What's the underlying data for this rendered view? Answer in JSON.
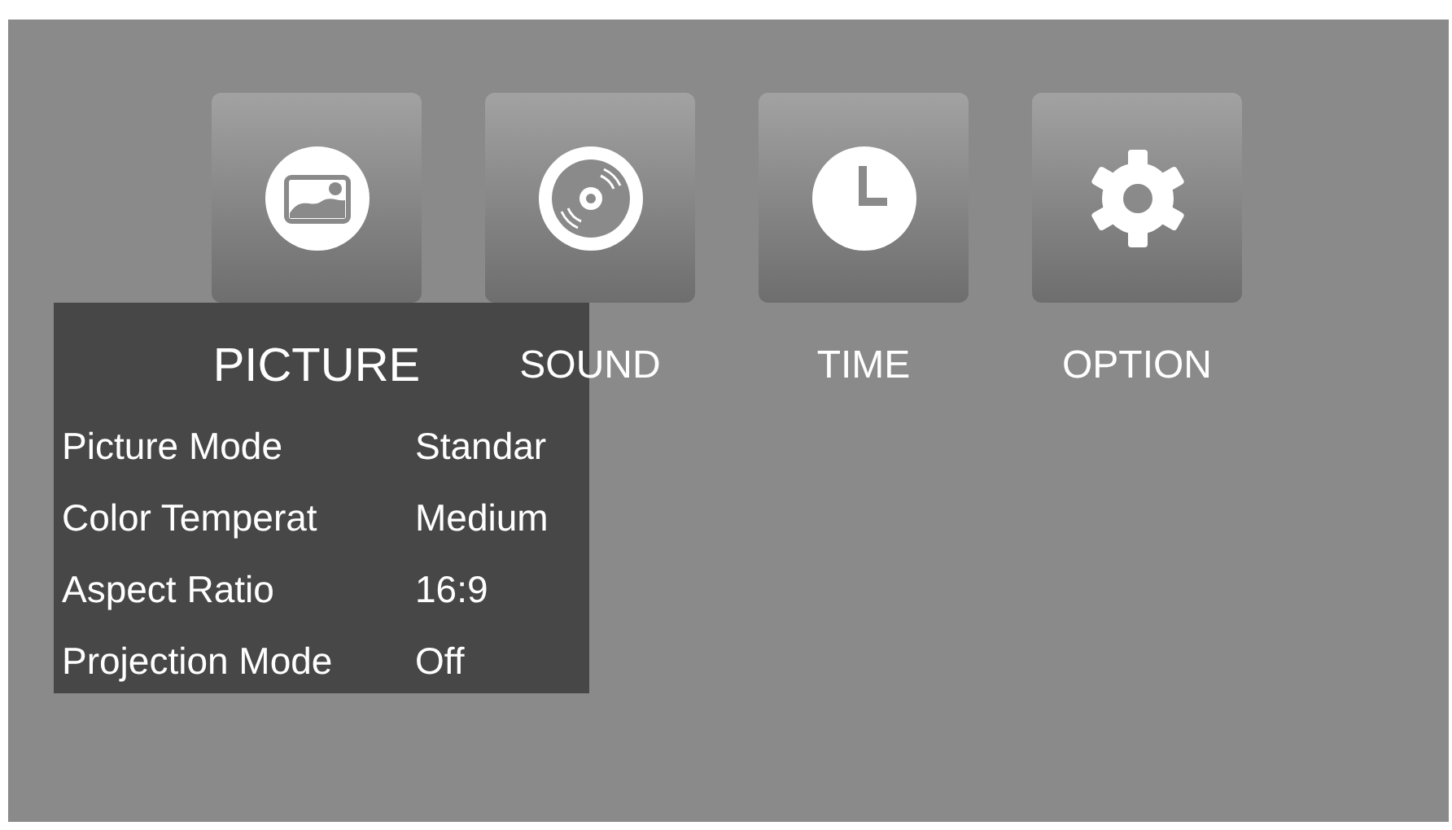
{
  "tabs": [
    {
      "label": "PICTURE",
      "selected": true
    },
    {
      "label": "SOUND",
      "selected": false
    },
    {
      "label": "TIME",
      "selected": false
    },
    {
      "label": "OPTION",
      "selected": false
    }
  ],
  "settings": [
    {
      "label": "Picture Mode",
      "value": "Standar"
    },
    {
      "label": "Color Temperat",
      "value": "Medium"
    },
    {
      "label": "Aspect Ratio",
      "value": "16:9"
    },
    {
      "label": "Projection Mode",
      "value": "Off"
    }
  ]
}
